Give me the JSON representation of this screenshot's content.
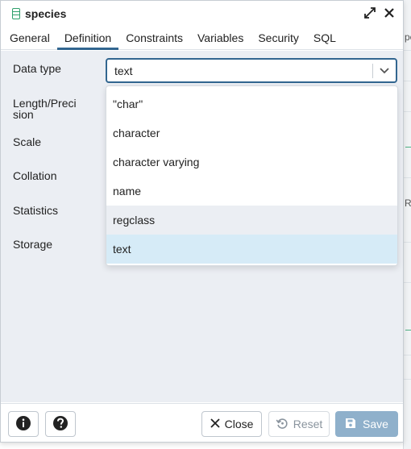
{
  "dialog": {
    "title": "species",
    "title_icon": "table-icon",
    "maximize_icon": "expand-icon",
    "close_icon": "close-icon"
  },
  "tabs": [
    {
      "label": "General",
      "active": false
    },
    {
      "label": "Definition",
      "active": true
    },
    {
      "label": "Constraints",
      "active": false
    },
    {
      "label": "Variables",
      "active": false
    },
    {
      "label": "Security",
      "active": false
    },
    {
      "label": "SQL",
      "active": false
    }
  ],
  "form": {
    "data_type_label": "Data type",
    "length_label": "Length/Preci sion",
    "scale_label": "Scale",
    "collation_label": "Collation",
    "statistics_label": "Statistics",
    "storage_label": "Storage",
    "data_type_value": "text"
  },
  "dropdown": {
    "options": [
      "\"char\"",
      "character",
      "character varying",
      "name",
      "regclass",
      "text"
    ],
    "hovered": "regclass",
    "selected": "text"
  },
  "footer": {
    "info_icon": "info-icon",
    "help_icon": "help-icon",
    "close_label": "Close",
    "reset_label": "Reset",
    "save_label": "Save"
  },
  "background": {
    "fragment_top": "pe",
    "fragment_mid": "Re"
  },
  "colors": {
    "accent": "#326690",
    "table_icon": "#2e9f6b",
    "body_bg": "#ebeef3",
    "selected_option_bg": "#d6ebf7",
    "save_button_bg": "#8fb0cb"
  }
}
